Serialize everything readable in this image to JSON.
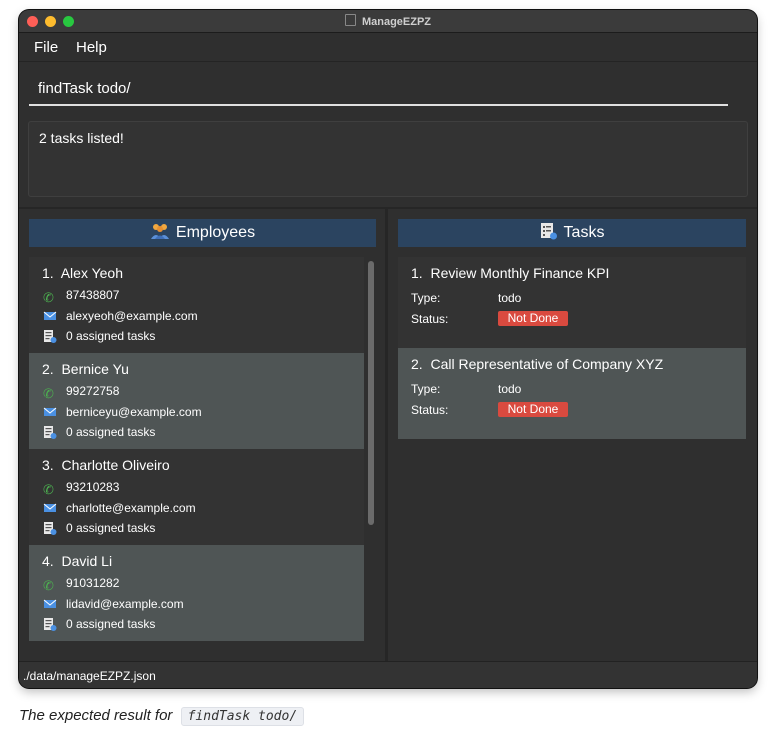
{
  "window": {
    "title": "ManageEZPZ"
  },
  "menu": {
    "file": "File",
    "help": "Help"
  },
  "command": {
    "value": "findTask todo/"
  },
  "result": {
    "text": "2 tasks listed!"
  },
  "employees_panel": {
    "title": "Employees",
    "items": [
      {
        "index": "1.",
        "name": "Alex Yeoh",
        "phone": "87438807",
        "email": "alexyeoh@example.com",
        "tasks": "0 assigned tasks"
      },
      {
        "index": "2.",
        "name": "Bernice Yu",
        "phone": "99272758",
        "email": "berniceyu@example.com",
        "tasks": "0 assigned tasks"
      },
      {
        "index": "3.",
        "name": "Charlotte Oliveiro",
        "phone": "93210283",
        "email": "charlotte@example.com",
        "tasks": "0 assigned tasks"
      },
      {
        "index": "4.",
        "name": "David Li",
        "phone": "91031282",
        "email": "lidavid@example.com",
        "tasks": "0 assigned tasks"
      }
    ]
  },
  "tasks_panel": {
    "title": "Tasks",
    "type_label": "Type:",
    "status_label": "Status:",
    "items": [
      {
        "index": "1.",
        "name": "Review Monthly Finance KPI",
        "type": "todo",
        "status": "Not Done"
      },
      {
        "index": "2.",
        "name": "Call Representative of Company XYZ",
        "type": "todo",
        "status": "Not Done"
      }
    ]
  },
  "statusbar": {
    "path": "./data/manageEZPZ.json"
  },
  "caption": {
    "text": "The expected result for",
    "code": "findTask todo/"
  },
  "colors": {
    "accent_header": "#2b4460",
    "status_not_done": "#d94a3f",
    "phone_icon": "#4caf50"
  }
}
